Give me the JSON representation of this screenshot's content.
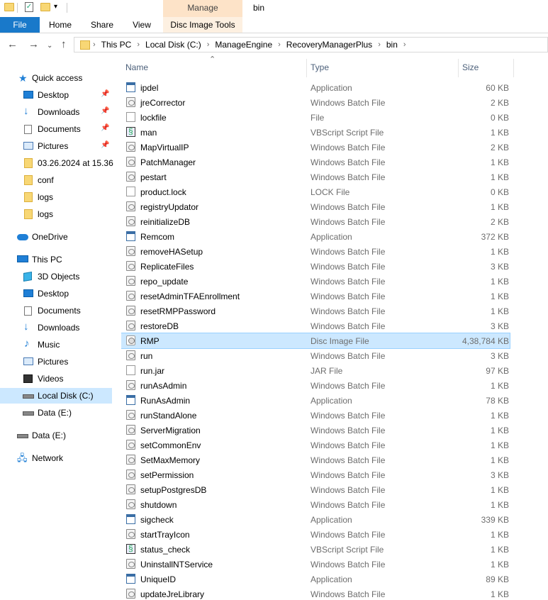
{
  "window": {
    "title": "bin",
    "contextual_group": "Manage"
  },
  "ribbon": {
    "tabs": [
      "File",
      "Home",
      "Share",
      "View",
      "Disc Image Tools"
    ]
  },
  "address": {
    "crumbs": [
      "This PC",
      "Local Disk (C:)",
      "ManageEngine",
      "RecoveryManagerPlus",
      "bin"
    ]
  },
  "sidebar": {
    "items": [
      {
        "label": "Quick access",
        "icon": "star-icon"
      },
      {
        "label": "Desktop",
        "icon": "desktop-icon",
        "pinned": true
      },
      {
        "label": "Downloads",
        "icon": "download-icon",
        "pinned": true
      },
      {
        "label": "Documents",
        "icon": "documents-icon",
        "pinned": true
      },
      {
        "label": "Pictures",
        "icon": "pictures-icon",
        "pinned": true
      },
      {
        "label": "03.26.2024 at 15.36",
        "icon": "folder-icon"
      },
      {
        "label": "conf",
        "icon": "folder-icon"
      },
      {
        "label": "logs",
        "icon": "folder-icon"
      },
      {
        "label": "logs",
        "icon": "folder-icon"
      },
      {
        "label": "OneDrive",
        "icon": "cloud-icon"
      },
      {
        "label": "This PC",
        "icon": "computer-icon"
      },
      {
        "label": "3D Objects",
        "icon": "cube-icon"
      },
      {
        "label": "Desktop",
        "icon": "desktop-icon"
      },
      {
        "label": "Documents",
        "icon": "documents-icon"
      },
      {
        "label": "Downloads",
        "icon": "download-icon"
      },
      {
        "label": "Music",
        "icon": "music-icon"
      },
      {
        "label": "Pictures",
        "icon": "pictures-icon"
      },
      {
        "label": "Videos",
        "icon": "video-icon"
      },
      {
        "label": "Local Disk (C:)",
        "icon": "drive-icon",
        "selected": true
      },
      {
        "label": "Data (E:)",
        "icon": "drive-icon"
      },
      {
        "label": "Data (E:)",
        "icon": "drive-icon"
      },
      {
        "label": "Network",
        "icon": "network-icon"
      }
    ]
  },
  "columns": {
    "name": "Name",
    "type": "Type",
    "size": "Size"
  },
  "files": [
    {
      "name": "ipdel",
      "type": "Application",
      "size": "60 KB",
      "icon": "app"
    },
    {
      "name": "jreCorrector",
      "type": "Windows Batch File",
      "size": "2 KB",
      "icon": "bat"
    },
    {
      "name": "lockfile",
      "type": "File",
      "size": "0 KB",
      "icon": "file"
    },
    {
      "name": "man",
      "type": "VBScript Script File",
      "size": "1 KB",
      "icon": "vbs"
    },
    {
      "name": "MapVirtualIP",
      "type": "Windows Batch File",
      "size": "2 KB",
      "icon": "bat"
    },
    {
      "name": "PatchManager",
      "type": "Windows Batch File",
      "size": "1 KB",
      "icon": "bat"
    },
    {
      "name": "pestart",
      "type": "Windows Batch File",
      "size": "1 KB",
      "icon": "bat"
    },
    {
      "name": "product.lock",
      "type": "LOCK File",
      "size": "0 KB",
      "icon": "file"
    },
    {
      "name": "registryUpdator",
      "type": "Windows Batch File",
      "size": "1 KB",
      "icon": "bat"
    },
    {
      "name": "reinitializeDB",
      "type": "Windows Batch File",
      "size": "2 KB",
      "icon": "bat"
    },
    {
      "name": "Remcom",
      "type": "Application",
      "size": "372 KB",
      "icon": "app"
    },
    {
      "name": "removeHASetup",
      "type": "Windows Batch File",
      "size": "1 KB",
      "icon": "bat"
    },
    {
      "name": "ReplicateFiles",
      "type": "Windows Batch File",
      "size": "3 KB",
      "icon": "bat"
    },
    {
      "name": "repo_update",
      "type": "Windows Batch File",
      "size": "1 KB",
      "icon": "bat"
    },
    {
      "name": "resetAdminTFAEnrollment",
      "type": "Windows Batch File",
      "size": "1 KB",
      "icon": "bat"
    },
    {
      "name": "resetRMPPassword",
      "type": "Windows Batch File",
      "size": "1 KB",
      "icon": "bat"
    },
    {
      "name": "restoreDB",
      "type": "Windows Batch File",
      "size": "3 KB",
      "icon": "bat"
    },
    {
      "name": "RMP",
      "type": "Disc Image File",
      "size": "4,38,784 KB",
      "icon": "iso",
      "selected": true
    },
    {
      "name": "run",
      "type": "Windows Batch File",
      "size": "3 KB",
      "icon": "bat"
    },
    {
      "name": "run.jar",
      "type": "JAR File",
      "size": "97 KB",
      "icon": "file"
    },
    {
      "name": "runAsAdmin",
      "type": "Windows Batch File",
      "size": "1 KB",
      "icon": "bat"
    },
    {
      "name": "RunAsAdmin",
      "type": "Application",
      "size": "78 KB",
      "icon": "app"
    },
    {
      "name": "runStandAlone",
      "type": "Windows Batch File",
      "size": "1 KB",
      "icon": "bat"
    },
    {
      "name": "ServerMigration",
      "type": "Windows Batch File",
      "size": "1 KB",
      "icon": "bat"
    },
    {
      "name": "setCommonEnv",
      "type": "Windows Batch File",
      "size": "1 KB",
      "icon": "bat"
    },
    {
      "name": "SetMaxMemory",
      "type": "Windows Batch File",
      "size": "1 KB",
      "icon": "bat"
    },
    {
      "name": "setPermission",
      "type": "Windows Batch File",
      "size": "3 KB",
      "icon": "bat"
    },
    {
      "name": "setupPostgresDB",
      "type": "Windows Batch File",
      "size": "1 KB",
      "icon": "bat"
    },
    {
      "name": "shutdown",
      "type": "Windows Batch File",
      "size": "1 KB",
      "icon": "bat"
    },
    {
      "name": "sigcheck",
      "type": "Application",
      "size": "339 KB",
      "icon": "app"
    },
    {
      "name": "startTrayIcon",
      "type": "Windows Batch File",
      "size": "1 KB",
      "icon": "bat"
    },
    {
      "name": "status_check",
      "type": "VBScript Script File",
      "size": "1 KB",
      "icon": "vbs"
    },
    {
      "name": "UninstallNTService",
      "type": "Windows Batch File",
      "size": "1 KB",
      "icon": "bat"
    },
    {
      "name": "UniqueID",
      "type": "Application",
      "size": "89 KB",
      "icon": "app"
    },
    {
      "name": "updateJreLibrary",
      "type": "Windows Batch File",
      "size": "1 KB",
      "icon": "bat"
    }
  ]
}
